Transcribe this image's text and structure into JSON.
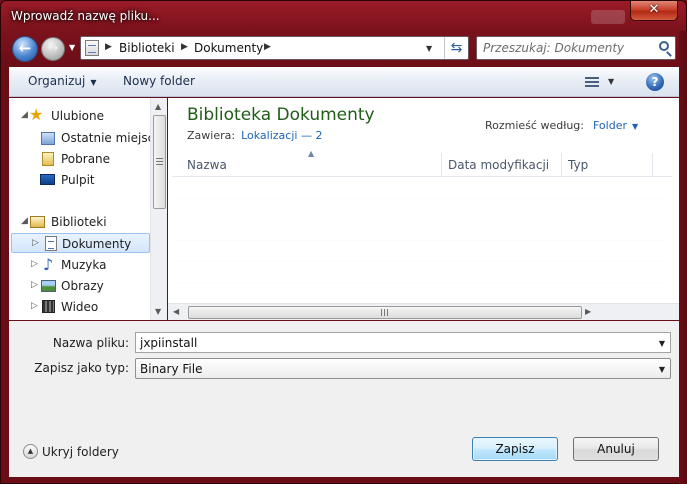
{
  "window": {
    "title": "Wprowadź nazwę pliku...",
    "close_glyph": "✕"
  },
  "address": {
    "crumbs": [
      "Biblioteki",
      "Dokumenty"
    ],
    "search_placeholder": "Przeszukaj: Dokumenty"
  },
  "toolbar": {
    "organize_label": "Organizuj",
    "new_folder_label": "Nowy folder",
    "help_glyph": "?"
  },
  "nav_pane": {
    "favorites_label": "Ulubione",
    "favorites": [
      "Ostatnie miejsca",
      "Pobrane",
      "Pulpit"
    ],
    "libraries_label": "Biblioteki",
    "libraries": [
      "Dokumenty",
      "Muzyka",
      "Obrazy",
      "Wideo"
    ],
    "selected": "Dokumenty"
  },
  "content": {
    "library_title": "Biblioteka Dokumenty",
    "includes_label": "Zawiera:",
    "includes_link": "Lokalizacji — 2",
    "arrange_label": "Rozmieść według:",
    "arrange_value": "Folder",
    "columns": [
      "Nazwa",
      "Data modyfikacji",
      "Typ"
    ]
  },
  "form": {
    "filename_label": "Nazwa pliku:",
    "filename_value": "jxpiinstall",
    "filetype_label": "Zapisz jako typ:",
    "filetype_value": "Binary File",
    "hide_folders_label": "Ukryj foldery",
    "save_label": "Zapisz",
    "cancel_label": "Anuluj"
  },
  "colors": {
    "frame": "#7b121c",
    "library_title": "#1f5d16",
    "link": "#1e63b5",
    "primary_button": "#bee6fd"
  }
}
